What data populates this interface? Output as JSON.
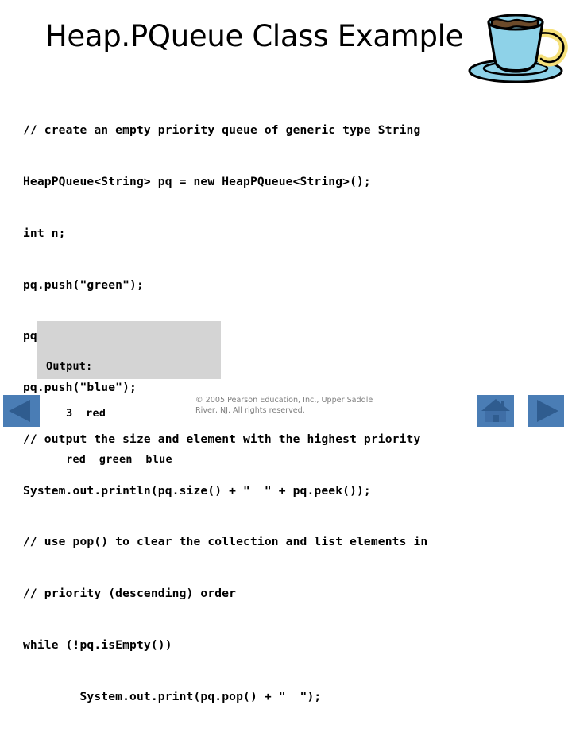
{
  "slide": {
    "title": "Heap.PQueue Class Example",
    "background_color": "#ffffff"
  },
  "artwork": {
    "coffee_cup": {
      "icon": "coffee-cup-icon",
      "cup_color": "#8ed2e8",
      "handle_color": "#f5e07a",
      "saucer_color": "#8ed2e8",
      "coffee_color": "#6b4a2a",
      "outline_color": "#000000"
    }
  },
  "code": {
    "lines": [
      "// create an empty priority queue of generic type String",
      "HeapPQueue<String> pq = new HeapPQueue<String>();",
      "int n;",
      "pq.push(\"green\");",
      "pq.push(\"red\");",
      "pq.push(\"blue\");",
      "// output the size and element with the highest priority",
      "System.out.println(pq.size() + \"  \" + pq.peek());",
      "// use pop() to clear the collection and list elements in",
      "// priority (descending) order",
      "while (!pq.isEmpty())",
      "        System.out.print(pq.pop() + \"  \");"
    ]
  },
  "output": {
    "background_color": "#d4d4d4",
    "lines": [
      "Output:",
      "   3  red",
      "   red  green  blue"
    ]
  },
  "footer": {
    "copyright": "© 2005 Pearson Education, Inc., Upper Saddle River, NJ.  All rights reserved.",
    "copyright_color": "#7f7f7f"
  },
  "navigation": {
    "button_color": "#4a7db5",
    "glyph_color": "#2f5c8f",
    "previous": {
      "icon": "triangle-left-icon",
      "label": "Previous slide"
    },
    "home": {
      "icon": "home-icon",
      "label": "Home"
    },
    "next": {
      "icon": "triangle-right-icon",
      "label": "Next slide"
    }
  }
}
